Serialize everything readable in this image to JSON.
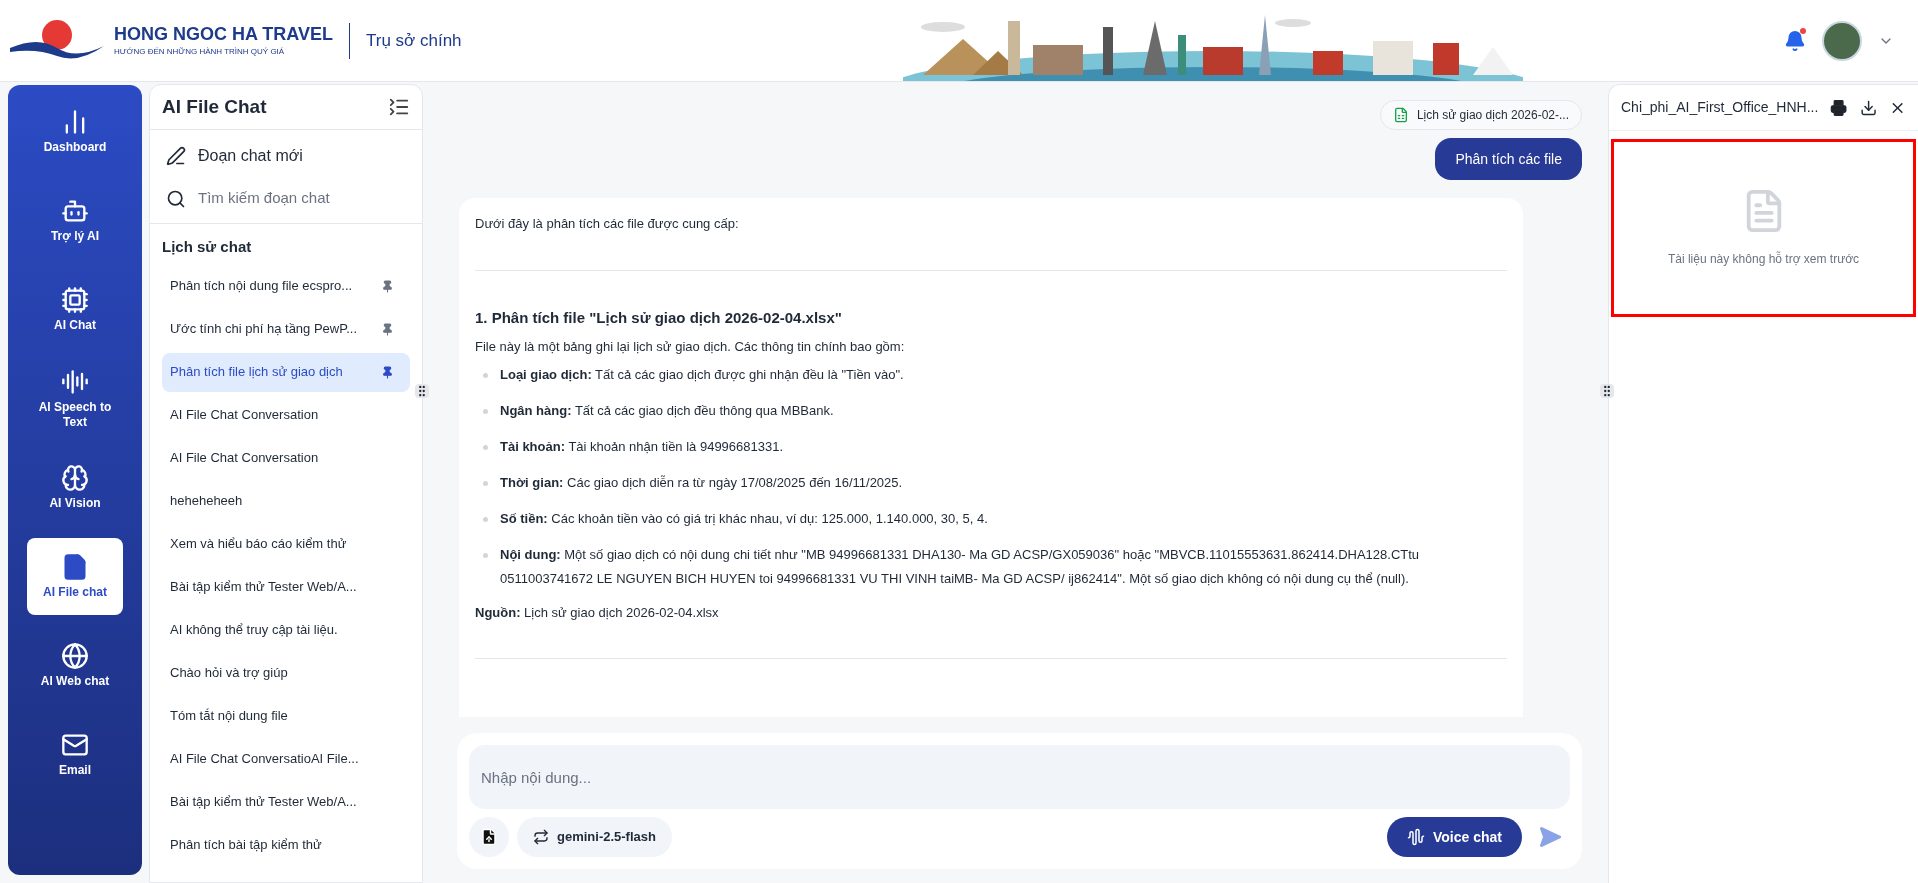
{
  "header": {
    "brand": "HONG NGOC HA TRAVEL",
    "slogan": "HƯỚNG ĐẾN NHỮNG HÀNH TRÌNH QUÝ GIÁ",
    "office": "Trụ sở chính",
    "notification_dot": true
  },
  "nav": [
    {
      "kind": "dashboard",
      "label": "Dashboard",
      "selected": false
    },
    {
      "kind": "bot",
      "label": "Trợ lý AI",
      "selected": false
    },
    {
      "kind": "chip",
      "label": "AI Chat",
      "selected": false
    },
    {
      "kind": "audio",
      "label": "AI Speech to Text",
      "selected": false
    },
    {
      "kind": "brain",
      "label": "AI Vision",
      "selected": false
    },
    {
      "kind": "file",
      "label": "AI File chat",
      "selected": true
    },
    {
      "kind": "globe",
      "label": "AI Web chat",
      "selected": false
    },
    {
      "kind": "mail",
      "label": "Email",
      "selected": false
    }
  ],
  "chat_list": {
    "title": "AI File Chat",
    "new_chat": "Đoạn chat mới",
    "search_placeholder": "Tìm kiếm đoạn chat",
    "history_title": "Lịch sử chat",
    "items": [
      {
        "label": "Phân tích nội dung file ecspro...",
        "pinned": true,
        "selected": false
      },
      {
        "label": "Ước tính chi phí hạ tầng PewP...",
        "pinned": true,
        "selected": false
      },
      {
        "label": "Phân tích file lịch sử giao dịch",
        "pinned": true,
        "selected": true
      },
      {
        "label": "AI File Chat Conversation",
        "pinned": false,
        "selected": false
      },
      {
        "label": "AI File Chat Conversation",
        "pinned": false,
        "selected": false
      },
      {
        "label": "heheheheeh",
        "pinned": false,
        "selected": false
      },
      {
        "label": "Xem và hiểu báo cáo kiểm thử",
        "pinned": false,
        "selected": false
      },
      {
        "label": "Bài tập kiểm thử Tester Web/A...",
        "pinned": false,
        "selected": false
      },
      {
        "label": "AI không thể truy cập tài liệu.",
        "pinned": false,
        "selected": false
      },
      {
        "label": "Chào hỏi và trợ giúp",
        "pinned": false,
        "selected": false
      },
      {
        "label": "Tóm tắt nội dung file",
        "pinned": false,
        "selected": false
      },
      {
        "label": "AI File Chat ConversatioAI File...",
        "pinned": false,
        "selected": false
      },
      {
        "label": "Bài tập kiểm thử Tester Web/A...",
        "pinned": false,
        "selected": false
      },
      {
        "label": "Phân tích bài tập kiểm thử",
        "pinned": false,
        "selected": false
      }
    ]
  },
  "conversation": {
    "attachment": "Lịch sử giao dịch 2026-02-...",
    "user_message": "Phân tích các file",
    "answer": {
      "intro": "Dưới đây là phân tích các file được cung cấp:",
      "heading": "1. Phân tích file \"Lịch sử giao dịch 2026-02-04.xlsx\"",
      "lead": "File này là một bảng ghi lại lịch sử giao dịch. Các thông tin chính bao gồm:",
      "bullets": [
        "**Loại giao dịch:** Tất cả các giao dịch được ghi nhận đều là \"Tiền vào\".",
        "**Ngân hàng:** Tất cả các giao dịch đều thông qua MBBank.",
        "**Tài khoản:** Tài khoản nhận tiền là 94996681331.",
        "**Thời gian:** Các giao dịch diễn ra từ ngày 17/08/2025 đến 16/11/2025.",
        "**Số tiền:** Các khoản tiền vào có giá trị khác nhau, ví dụ: 125.000, 1.140.000, 30, 5, 4.",
        "**Nội dung:** Một số giao dịch có nội dung chi tiết như \"MB 94996681331 DHA130- Ma GD ACSP/GX059036\" hoặc \"MBVCB.11015553631.862414.DHA128.CTtu 0511003741672 LE NGUYEN BICH HUYEN toi 94996681331 VU THI VINH taiMB- Ma GD ACSP/ ij862414\". Một số giao dịch không có nội dung cụ thể (null)."
      ],
      "source": "**Nguồn:** Lịch sử giao dịch 2026-02-04.xlsx"
    }
  },
  "composer": {
    "placeholder": "Nhập nội dung...",
    "model": "gemini-2.5-flash",
    "voice_button": "Voice chat"
  },
  "preview": {
    "file_name": "Chi_phi_AI_First_Office_HNH...",
    "message": "Tài liệu này không hỗ trợ xem trước",
    "highlighted": true
  }
}
